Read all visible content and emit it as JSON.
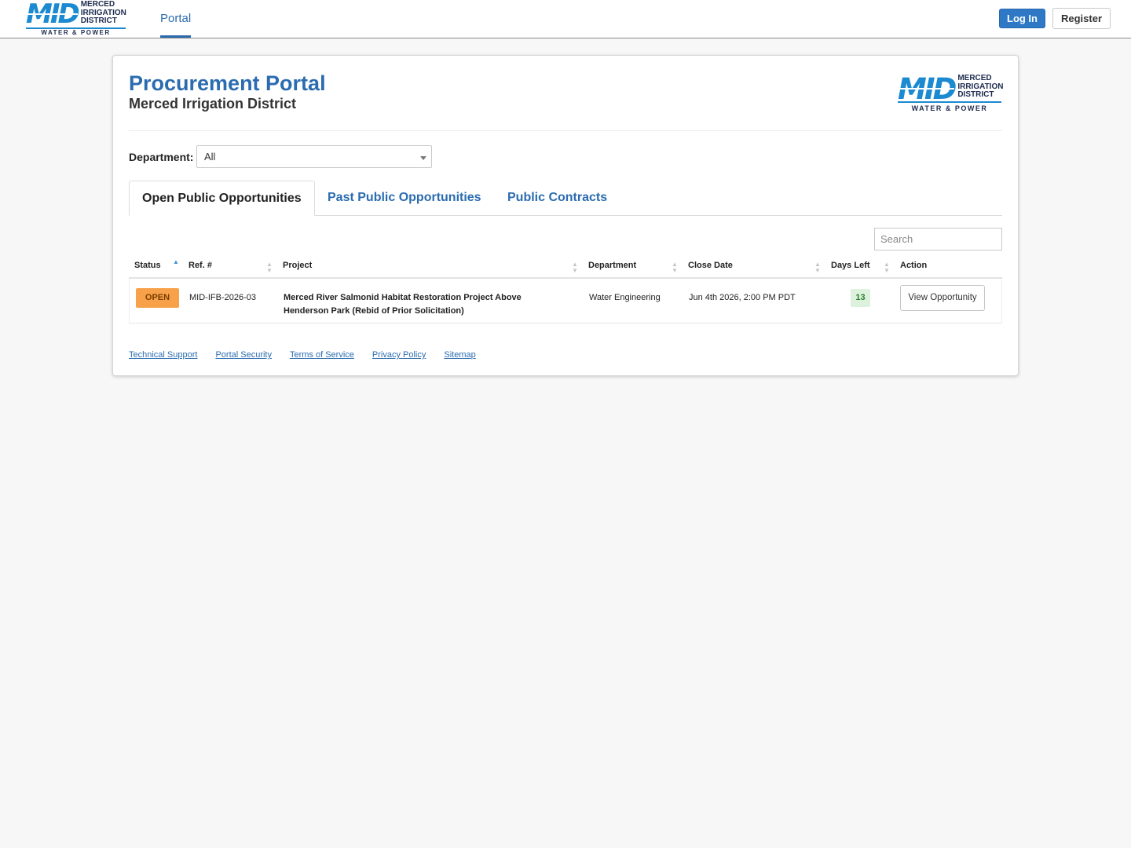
{
  "brand": {
    "mark": "MID",
    "words": [
      "MERCED",
      "IRRIGATION",
      "DISTRICT"
    ],
    "tagline": "WATER & POWER"
  },
  "nav": {
    "portal_label": "Portal",
    "login_label": "Log In",
    "register_label": "Register"
  },
  "header": {
    "title": "Procurement Portal",
    "subtitle": "Merced Irrigation District"
  },
  "filter": {
    "department_label": "Department:",
    "department_value": "All"
  },
  "tabs": [
    {
      "label": "Open Public Opportunities",
      "active": true
    },
    {
      "label": "Past Public Opportunities",
      "active": false
    },
    {
      "label": "Public Contracts",
      "active": false
    }
  ],
  "search": {
    "placeholder": "Search"
  },
  "table": {
    "columns": [
      "Status",
      "Ref. #",
      "Project",
      "Department",
      "Close Date",
      "Days Left",
      "Action"
    ],
    "rows": [
      {
        "status": "OPEN",
        "ref": "MID-IFB-2026-03",
        "project": "Merced River Salmonid Habitat Restoration Project Above Henderson Park (Rebid of Prior Solicitation)",
        "department": "Water Engineering",
        "close_date": "Jun 4th 2026, 2:00 PM PDT",
        "days_left": "13",
        "action": "View Opportunity"
      }
    ]
  },
  "footer": {
    "links": [
      "Technical Support",
      "Portal Security",
      "Terms of Service",
      "Privacy Policy",
      "Sitemap"
    ]
  },
  "colors": {
    "brand_blue": "#2b6cb0",
    "logo_blue": "#1b8ad1",
    "status_open": "#f7a24a",
    "days_badge": "#ddf2dd"
  }
}
